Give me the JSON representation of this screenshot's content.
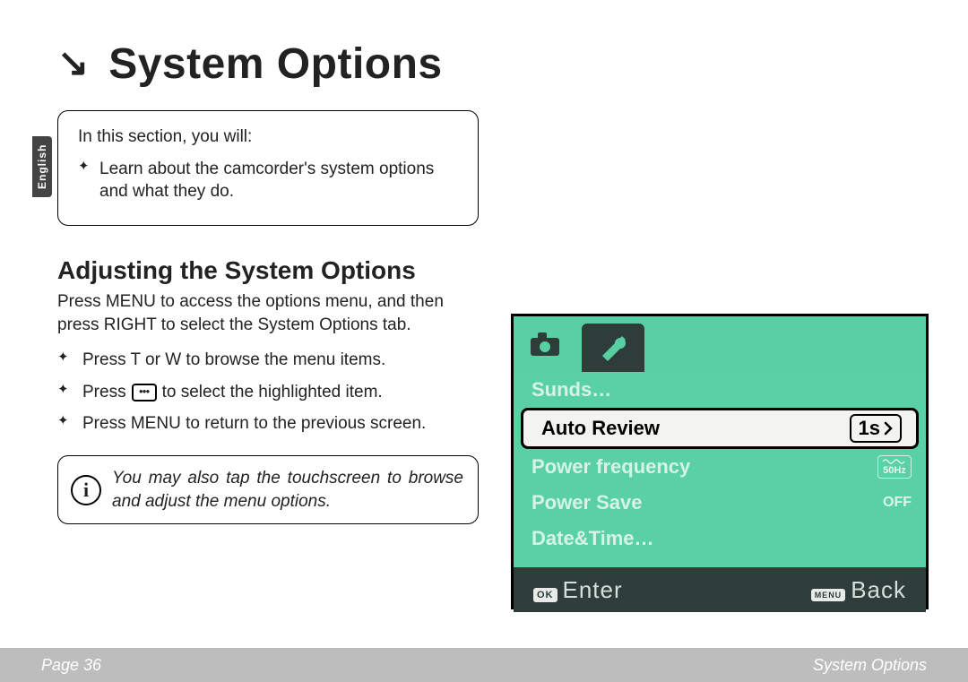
{
  "language_tab": "English",
  "title": "System Options",
  "section_intro": {
    "lead": "In this section, you will:",
    "bullets": [
      "Learn about the camcorder's system options and what they do."
    ]
  },
  "subheading": "Adjusting the System Options",
  "intro_paragraph": "Press MENU to access the options menu, and then press RIGHT to select the System Options tab.",
  "steps": {
    "s1": "Press T or W to browse the menu items.",
    "s2a": "Press ",
    "s2b": " to select the highlighted item.",
    "s3": "Press MENU to return to the previous screen."
  },
  "tip": "You may also tap the touchscreen to browse and adjust the menu options.",
  "device": {
    "menu": [
      {
        "label": "Sunds…",
        "value": ""
      },
      {
        "label": "Auto Review",
        "value": "1s"
      },
      {
        "label": "Power frequency",
        "value": "50Hz"
      },
      {
        "label": "Power Save",
        "value": "OFF"
      },
      {
        "label": "Date&Time…",
        "value": ""
      }
    ],
    "footer": {
      "ok_key": "OK",
      "enter": "Enter",
      "menu_key": "MENU",
      "back": "Back"
    }
  },
  "page_footer": {
    "left": "Page 36",
    "right": "System Options"
  }
}
